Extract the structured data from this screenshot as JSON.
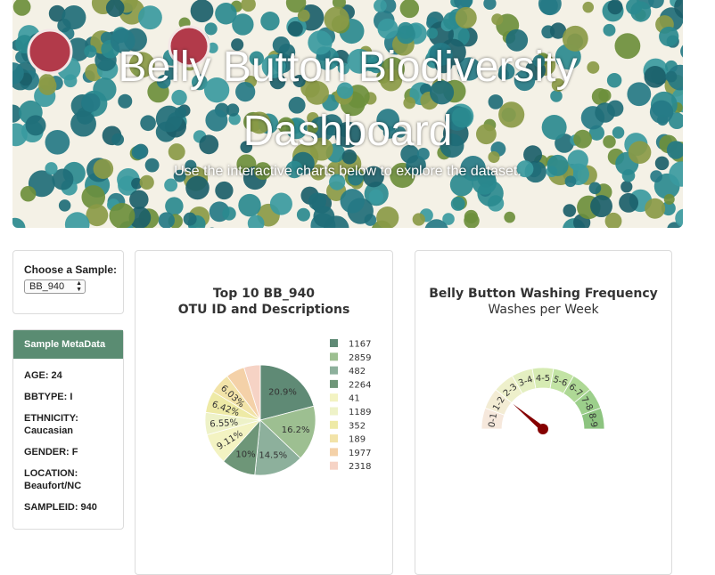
{
  "header": {
    "title": "Belly Button Biodiversity Dashboard",
    "subtitle": "Use the interactive charts below to explore the dataset."
  },
  "selector": {
    "label": "Choose a Sample:",
    "selected": "BB_940"
  },
  "metadata": {
    "heading": "Sample MetaData",
    "items": [
      "AGE: 24",
      "BBTYPE: I",
      "ETHNICITY: Caucasian",
      "GENDER: F",
      "LOCATION: Beaufort/NC",
      "SAMPLEID: 940"
    ]
  },
  "colors": {
    "accent": "#5a8c72",
    "needle": "#850000"
  },
  "chart_data": [
    {
      "type": "pie",
      "title": "Top 10 BB_940",
      "subtitle": "OTU ID and Descriptions",
      "labels": [
        "1167",
        "2859",
        "482",
        "2264",
        "41",
        "1189",
        "352",
        "189",
        "1977",
        "2318"
      ],
      "values": [
        20.9,
        16.2,
        14.5,
        10.0,
        9.11,
        6.55,
        6.42,
        6.03,
        5.5,
        4.79
      ],
      "shown_labels": [
        "20.9%",
        "16.2%",
        "14.5%",
        "10%",
        "9.11%",
        "6.55%",
        "6.42%",
        "6.03%",
        "",
        ""
      ],
      "colors": [
        "#5f8a75",
        "#9dbf91",
        "#8db09c",
        "#6e9678",
        "#f3f3c2",
        "#eef2c8",
        "#eeeaa6",
        "#f2e3a8",
        "#f4d1a8",
        "#f6d3c5"
      ],
      "legend": "right"
    },
    {
      "type": "gauge",
      "title": "Belly Button Washing Frequency",
      "subtitle": "Washes per Week",
      "segments": [
        "0-1",
        "1-2",
        "2-3",
        "3-4",
        "4-5",
        "5-6",
        "6-7",
        "7-8",
        "8-9"
      ],
      "segment_colors": [
        "#f6e8dc",
        "#f3ecd4",
        "#eef0cb",
        "#e4efc1",
        "#d6ebb3",
        "#c2e3a4",
        "#aed895",
        "#9ccf8b",
        "#8dc480"
      ],
      "value": 2
    }
  ]
}
